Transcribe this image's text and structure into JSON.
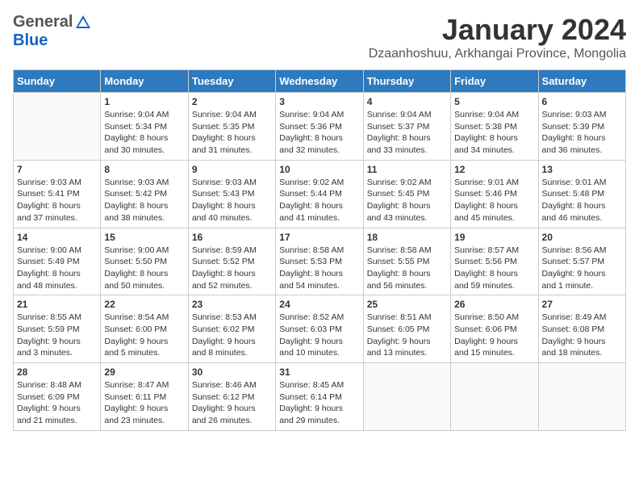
{
  "logo": {
    "general": "General",
    "blue": "Blue"
  },
  "title": "January 2024",
  "subtitle": "Dzaanhoshuu, Arkhangai Province, Mongolia",
  "days_of_week": [
    "Sunday",
    "Monday",
    "Tuesday",
    "Wednesday",
    "Thursday",
    "Friday",
    "Saturday"
  ],
  "weeks": [
    [
      {
        "num": "",
        "detail": ""
      },
      {
        "num": "1",
        "detail": "Sunrise: 9:04 AM\nSunset: 5:34 PM\nDaylight: 8 hours\nand 30 minutes."
      },
      {
        "num": "2",
        "detail": "Sunrise: 9:04 AM\nSunset: 5:35 PM\nDaylight: 8 hours\nand 31 minutes."
      },
      {
        "num": "3",
        "detail": "Sunrise: 9:04 AM\nSunset: 5:36 PM\nDaylight: 8 hours\nand 32 minutes."
      },
      {
        "num": "4",
        "detail": "Sunrise: 9:04 AM\nSunset: 5:37 PM\nDaylight: 8 hours\nand 33 minutes."
      },
      {
        "num": "5",
        "detail": "Sunrise: 9:04 AM\nSunset: 5:38 PM\nDaylight: 8 hours\nand 34 minutes."
      },
      {
        "num": "6",
        "detail": "Sunrise: 9:03 AM\nSunset: 5:39 PM\nDaylight: 8 hours\nand 36 minutes."
      }
    ],
    [
      {
        "num": "7",
        "detail": "Sunrise: 9:03 AM\nSunset: 5:41 PM\nDaylight: 8 hours\nand 37 minutes."
      },
      {
        "num": "8",
        "detail": "Sunrise: 9:03 AM\nSunset: 5:42 PM\nDaylight: 8 hours\nand 38 minutes."
      },
      {
        "num": "9",
        "detail": "Sunrise: 9:03 AM\nSunset: 5:43 PM\nDaylight: 8 hours\nand 40 minutes."
      },
      {
        "num": "10",
        "detail": "Sunrise: 9:02 AM\nSunset: 5:44 PM\nDaylight: 8 hours\nand 41 minutes."
      },
      {
        "num": "11",
        "detail": "Sunrise: 9:02 AM\nSunset: 5:45 PM\nDaylight: 8 hours\nand 43 minutes."
      },
      {
        "num": "12",
        "detail": "Sunrise: 9:01 AM\nSunset: 5:46 PM\nDaylight: 8 hours\nand 45 minutes."
      },
      {
        "num": "13",
        "detail": "Sunrise: 9:01 AM\nSunset: 5:48 PM\nDaylight: 8 hours\nand 46 minutes."
      }
    ],
    [
      {
        "num": "14",
        "detail": "Sunrise: 9:00 AM\nSunset: 5:49 PM\nDaylight: 8 hours\nand 48 minutes."
      },
      {
        "num": "15",
        "detail": "Sunrise: 9:00 AM\nSunset: 5:50 PM\nDaylight: 8 hours\nand 50 minutes."
      },
      {
        "num": "16",
        "detail": "Sunrise: 8:59 AM\nSunset: 5:52 PM\nDaylight: 8 hours\nand 52 minutes."
      },
      {
        "num": "17",
        "detail": "Sunrise: 8:58 AM\nSunset: 5:53 PM\nDaylight: 8 hours\nand 54 minutes."
      },
      {
        "num": "18",
        "detail": "Sunrise: 8:58 AM\nSunset: 5:55 PM\nDaylight: 8 hours\nand 56 minutes."
      },
      {
        "num": "19",
        "detail": "Sunrise: 8:57 AM\nSunset: 5:56 PM\nDaylight: 8 hours\nand 59 minutes."
      },
      {
        "num": "20",
        "detail": "Sunrise: 8:56 AM\nSunset: 5:57 PM\nDaylight: 9 hours\nand 1 minute."
      }
    ],
    [
      {
        "num": "21",
        "detail": "Sunrise: 8:55 AM\nSunset: 5:59 PM\nDaylight: 9 hours\nand 3 minutes."
      },
      {
        "num": "22",
        "detail": "Sunrise: 8:54 AM\nSunset: 6:00 PM\nDaylight: 9 hours\nand 5 minutes."
      },
      {
        "num": "23",
        "detail": "Sunrise: 8:53 AM\nSunset: 6:02 PM\nDaylight: 9 hours\nand 8 minutes."
      },
      {
        "num": "24",
        "detail": "Sunrise: 8:52 AM\nSunset: 6:03 PM\nDaylight: 9 hours\nand 10 minutes."
      },
      {
        "num": "25",
        "detail": "Sunrise: 8:51 AM\nSunset: 6:05 PM\nDaylight: 9 hours\nand 13 minutes."
      },
      {
        "num": "26",
        "detail": "Sunrise: 8:50 AM\nSunset: 6:06 PM\nDaylight: 9 hours\nand 15 minutes."
      },
      {
        "num": "27",
        "detail": "Sunrise: 8:49 AM\nSunset: 6:08 PM\nDaylight: 9 hours\nand 18 minutes."
      }
    ],
    [
      {
        "num": "28",
        "detail": "Sunrise: 8:48 AM\nSunset: 6:09 PM\nDaylight: 9 hours\nand 21 minutes."
      },
      {
        "num": "29",
        "detail": "Sunrise: 8:47 AM\nSunset: 6:11 PM\nDaylight: 9 hours\nand 23 minutes."
      },
      {
        "num": "30",
        "detail": "Sunrise: 8:46 AM\nSunset: 6:12 PM\nDaylight: 9 hours\nand 26 minutes."
      },
      {
        "num": "31",
        "detail": "Sunrise: 8:45 AM\nSunset: 6:14 PM\nDaylight: 9 hours\nand 29 minutes."
      },
      {
        "num": "",
        "detail": ""
      },
      {
        "num": "",
        "detail": ""
      },
      {
        "num": "",
        "detail": ""
      }
    ]
  ]
}
